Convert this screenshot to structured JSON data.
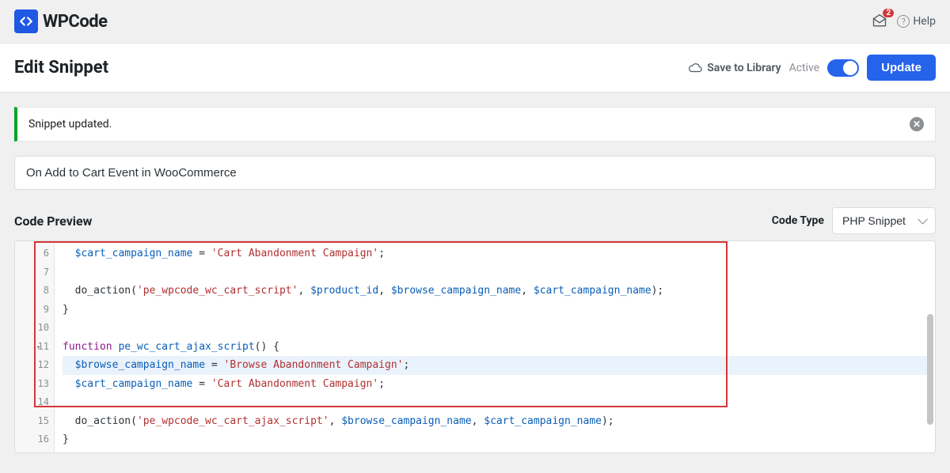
{
  "brand": {
    "name": "WPCode"
  },
  "topbar": {
    "notif_count": "2",
    "help_label": "Help"
  },
  "header": {
    "title": "Edit Snippet",
    "save_to_library": "Save to Library",
    "active_label": "Active",
    "update_btn": "Update"
  },
  "alert": {
    "message": "Snippet updated."
  },
  "snippet": {
    "title": "On Add to Cart Event in WooCommerce"
  },
  "labels": {
    "code_preview": "Code Preview",
    "code_type": "Code Type"
  },
  "code_type": {
    "selected": "PHP Snippet"
  },
  "code": {
    "lines": [
      {
        "num": "6",
        "tokens": [
          [
            "fn",
            "  "
          ],
          [
            "var",
            "$cart_campaign_name"
          ],
          [
            "op",
            " = "
          ],
          [
            "str",
            "'Cart Abandonment Campaign'"
          ],
          [
            "pun",
            ";"
          ]
        ]
      },
      {
        "num": "7",
        "tokens": []
      },
      {
        "num": "8",
        "tokens": [
          [
            "fn",
            "  "
          ],
          [
            "fn",
            "do_action"
          ],
          [
            "pun",
            "("
          ],
          [
            "str",
            "'pe_wpcode_wc_cart_script'"
          ],
          [
            "pun",
            ", "
          ],
          [
            "var",
            "$product_id"
          ],
          [
            "pun",
            ", "
          ],
          [
            "var",
            "$browse_campaign_name"
          ],
          [
            "pun",
            ", "
          ],
          [
            "var",
            "$cart_campaign_name"
          ],
          [
            "pun",
            ");"
          ]
        ]
      },
      {
        "num": "9",
        "tokens": [
          [
            "pun",
            "}"
          ]
        ]
      },
      {
        "num": "10",
        "tokens": []
      },
      {
        "num": "11",
        "fold": true,
        "tokens": [
          [
            "kw",
            "function"
          ],
          [
            "fn",
            " "
          ],
          [
            "var",
            "pe_wc_cart_ajax_script"
          ],
          [
            "pun",
            "() {"
          ]
        ]
      },
      {
        "num": "12",
        "hl": true,
        "tokens": [
          [
            "fn",
            "  "
          ],
          [
            "var",
            "$browse_campaign_name"
          ],
          [
            "op",
            " = "
          ],
          [
            "str",
            "'Browse Abandonment Campaign'"
          ],
          [
            "pun",
            ";"
          ]
        ]
      },
      {
        "num": "13",
        "tokens": [
          [
            "fn",
            "  "
          ],
          [
            "var",
            "$cart_campaign_name"
          ],
          [
            "op",
            " = "
          ],
          [
            "str",
            "'Cart Abandonment Campaign'"
          ],
          [
            "pun",
            ";"
          ]
        ]
      },
      {
        "num": "14",
        "tokens": []
      },
      {
        "num": "15",
        "tokens": [
          [
            "fn",
            "  "
          ],
          [
            "fn",
            "do_action"
          ],
          [
            "pun",
            "("
          ],
          [
            "str",
            "'pe_wpcode_wc_cart_ajax_script'"
          ],
          [
            "pun",
            ", "
          ],
          [
            "var",
            "$browse_campaign_name"
          ],
          [
            "pun",
            ", "
          ],
          [
            "var",
            "$cart_campaign_name"
          ],
          [
            "pun",
            ");"
          ]
        ]
      },
      {
        "num": "16",
        "tokens": [
          [
            "pun",
            "}"
          ]
        ]
      }
    ]
  }
}
